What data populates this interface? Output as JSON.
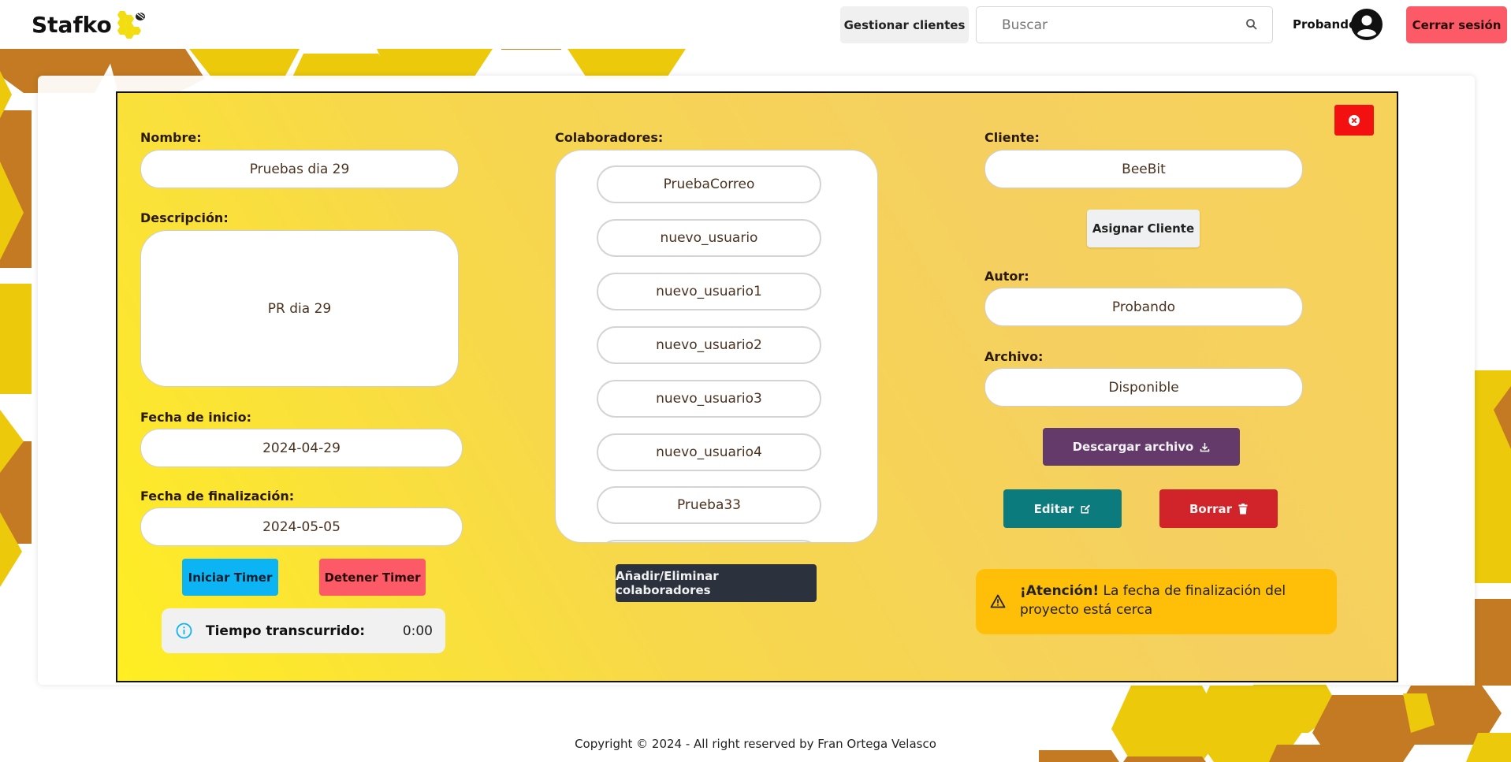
{
  "navbar": {
    "brand": "Stafko",
    "manage_clients": "Gestionar clientes",
    "search_placeholder": "Buscar",
    "user_name": "Probando",
    "logout": "Cerrar sesión"
  },
  "project": {
    "name_label": "Nombre:",
    "name_value": "Pruebas dia 29",
    "description_label": "Descripción:",
    "description_value": "PR dia 29",
    "start_label": "Fecha de inicio:",
    "start_value": "2024-04-29",
    "end_label": "Fecha de finalización:",
    "end_value": "2024-05-05",
    "timer_start": "Iniciar Timer",
    "timer_stop": "Detener Timer",
    "elapsed_label": "Tiempo transcurrido:",
    "elapsed_value": "0:00",
    "collaborators_label": "Colaboradores:",
    "collaborators": [
      "PruebaCorreo",
      "nuevo_usuario",
      "nuevo_usuario1",
      "nuevo_usuario2",
      "nuevo_usuario3",
      "nuevo_usuario4",
      "Prueba33"
    ],
    "collaborators_button": "Añadir/Eliminar colaboradores",
    "client_label": "Cliente:",
    "client_value": "BeeBit",
    "assign_client": "Asignar Cliente",
    "author_label": "Autor:",
    "author_value": "Probando",
    "file_label": "Archivo:",
    "file_value": "Disponible",
    "download_button": "Descargar archivo",
    "edit_button": "Editar",
    "delete_button": "Borrar",
    "alert_strong": "¡Atención!",
    "alert_text": " La fecha de finalización del proyecto está cerca"
  },
  "footer": {
    "copyright": "Copyright © 2024 - All right reserved by Fran Ortega Velasco"
  },
  "colors": {
    "honey_dark": "#c47a22",
    "honey_light": "#ecc90b",
    "danger": "#f21010",
    "info": "#0cb4f4",
    "warning": "#ffbf09"
  }
}
